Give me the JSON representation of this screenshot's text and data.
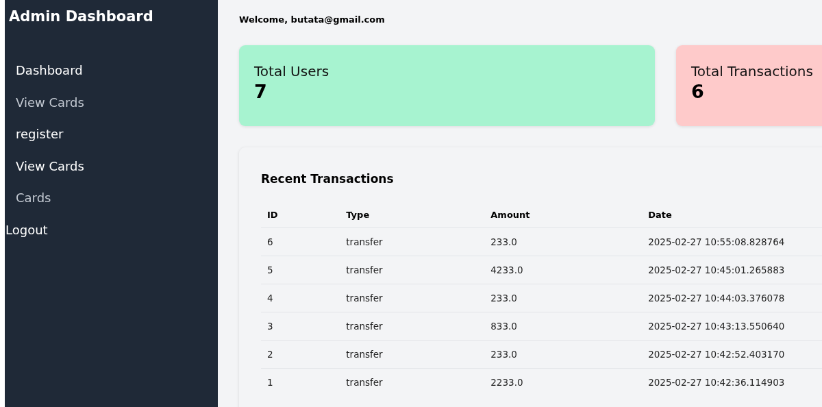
{
  "sidebar": {
    "title": "Admin Dashboard",
    "items": [
      {
        "label": "Dashboard",
        "kind": "nav"
      },
      {
        "label": "View Cards",
        "kind": "muted"
      },
      {
        "label": "register",
        "kind": "nav"
      },
      {
        "label": "View Cards",
        "kind": "nav"
      },
      {
        "label": "Cards",
        "kind": "muted"
      },
      {
        "label": "Logout",
        "kind": "action"
      }
    ]
  },
  "welcome": "Welcome, butata@gmail.com",
  "stats": [
    {
      "label": "Total Users",
      "value": "7",
      "color": "#a7f3d0"
    },
    {
      "label": "Total Transactions",
      "value": "6",
      "color": "#fecaca"
    }
  ],
  "transactions": {
    "title": "Recent Transactions",
    "columns": [
      "ID",
      "Type",
      "Amount",
      "Date"
    ],
    "rows": [
      [
        "6",
        "transfer",
        "233.0",
        "2025-02-27 10:55:08.828764"
      ],
      [
        "5",
        "transfer",
        "4233.0",
        "2025-02-27 10:45:01.265883"
      ],
      [
        "4",
        "transfer",
        "233.0",
        "2025-02-27 10:44:03.376078"
      ],
      [
        "3",
        "transfer",
        "833.0",
        "2025-02-27 10:43:13.550640"
      ],
      [
        "2",
        "transfer",
        "233.0",
        "2025-02-27 10:42:52.403170"
      ],
      [
        "1",
        "transfer",
        "2233.0",
        "2025-02-27 10:42:36.114903"
      ]
    ]
  }
}
